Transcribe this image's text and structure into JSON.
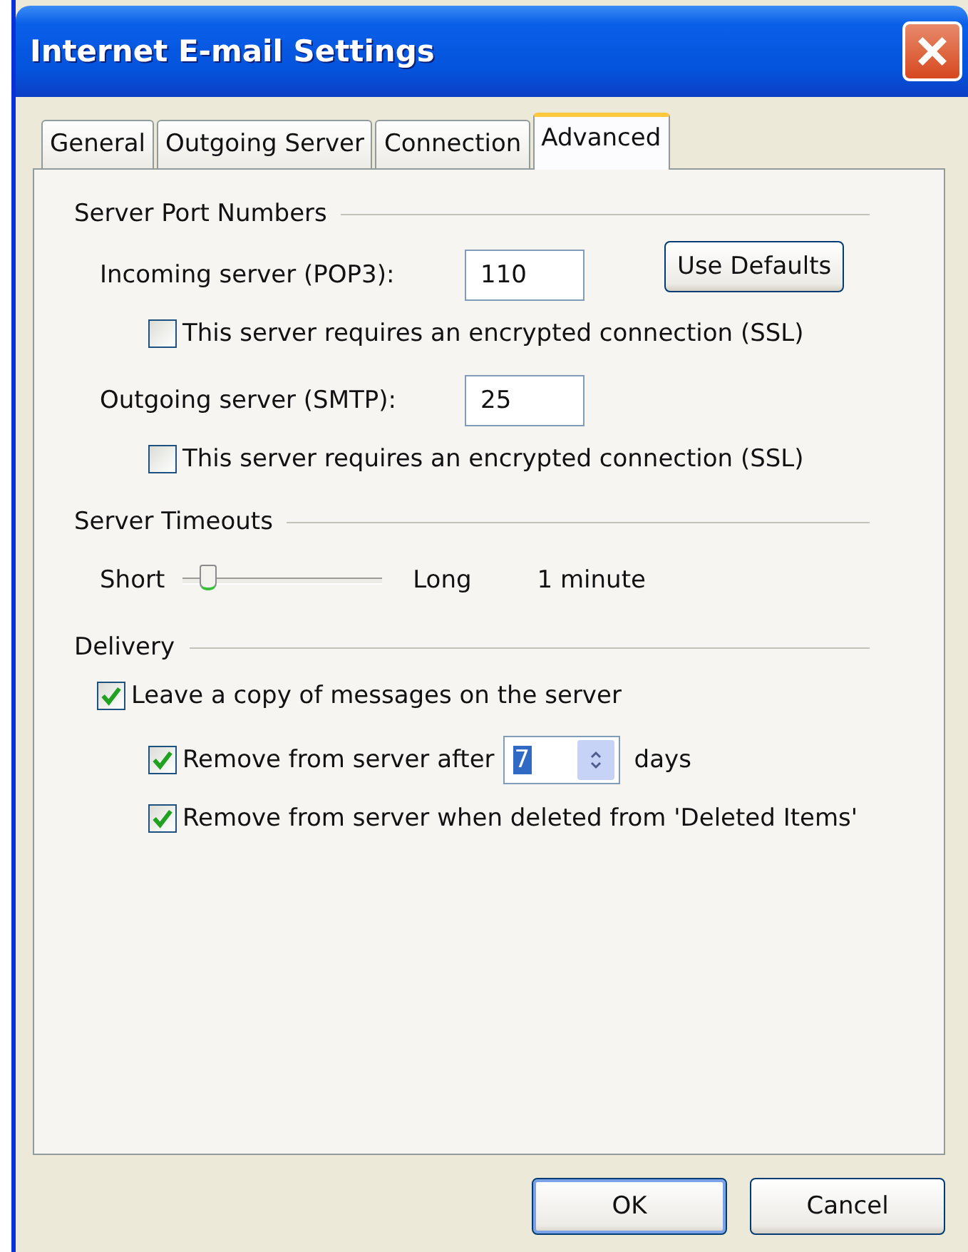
{
  "window": {
    "title": "Internet E-mail Settings"
  },
  "tabs": [
    {
      "label": "General",
      "selected": false
    },
    {
      "label": "Outgoing Server",
      "selected": false
    },
    {
      "label": "Connection",
      "selected": false
    },
    {
      "label": "Advanced",
      "selected": true
    }
  ],
  "port_numbers": {
    "title": "Server Port Numbers",
    "incoming": {
      "label": "Incoming server (POP3):",
      "value": "110"
    },
    "incoming_ssl": {
      "label": "This server requires an encrypted connection (SSL)",
      "checked": false
    },
    "use_defaults": "Use Defaults",
    "outgoing": {
      "label": "Outgoing server (SMTP):",
      "value": "25"
    },
    "outgoing_ssl": {
      "label": "This server requires an encrypted connection (SSL)",
      "checked": false
    }
  },
  "timeouts": {
    "title": "Server Timeouts",
    "min_label": "Short",
    "max_label": "Long",
    "level": 0.1,
    "reading": "1 minute"
  },
  "delivery": {
    "title": "Delivery",
    "leave_copy": {
      "label": "Leave a copy of messages on the server",
      "checked": true
    },
    "remove_after": {
      "label": "Remove from server after",
      "value": "7",
      "unit": "days",
      "checked": true
    },
    "remove_deleted": {
      "label": "Remove from server when deleted from 'Deleted Items'",
      "checked": true
    }
  },
  "buttons": [
    {
      "label": "OK",
      "default": true
    },
    {
      "label": "Cancel",
      "default": false
    }
  ]
}
